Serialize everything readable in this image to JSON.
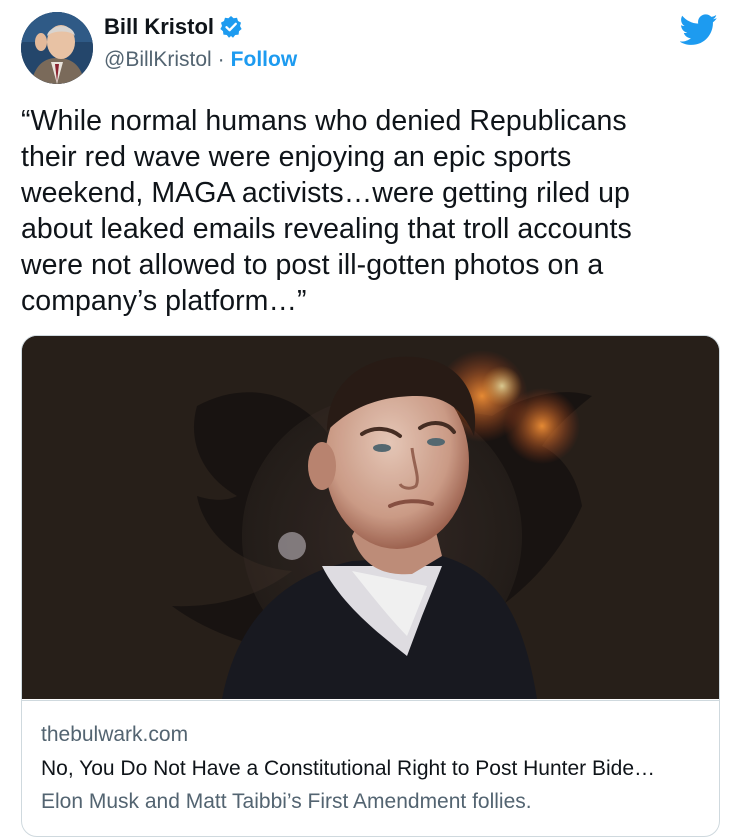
{
  "author": {
    "display_name": "Bill Kristol",
    "handle": "@BillKristol",
    "separator": "·",
    "follow_label": "Follow",
    "verified_color": "#1d9bf0",
    "avatar_icon": "avatar-photo",
    "brand_icon": "twitter-bird-icon"
  },
  "tweet": {
    "lines": [
      "“While normal humans who denied Republicans",
      "their red wave were enjoying an epic sports",
      "weekend, MAGA activists…were getting riled up",
      "about leaked emails revealing that troll accounts",
      "were not allowed to post ill-gotten photos on a",
      "company’s platform…”"
    ]
  },
  "card": {
    "image": "article-photo",
    "domain": "thebulwark.com",
    "title": "No, You Do Not Have a Constitutional Right to Post Hunter Bide…",
    "description": "Elon Musk and Matt Taibbi’s First Amendment follies."
  },
  "colors": {
    "accent": "#1d9bf0",
    "text": "#0f1419",
    "secondary": "#536471",
    "border": "#cfd9de"
  }
}
